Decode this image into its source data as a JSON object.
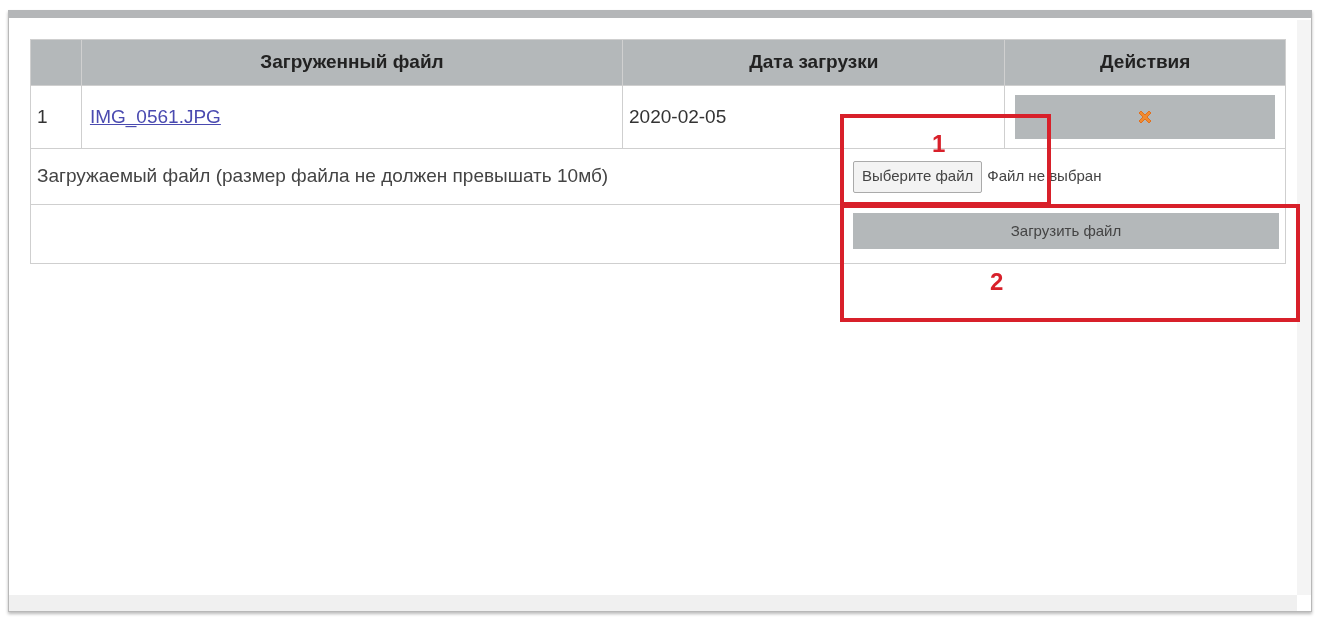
{
  "table": {
    "columns": [
      {},
      {
        "label": "Загруженный файл"
      },
      {
        "label": "Дата загрузки"
      },
      {
        "label": "Действия"
      }
    ],
    "rows": [
      {
        "index": "1",
        "file": "IMG_0561.JPG",
        "date": "2020-02-05"
      }
    ]
  },
  "upload": {
    "label": "Загружаемый файл (размер файла не должен превышать 10мб)",
    "choose_button": "Выберите файл",
    "no_file": "Файл не выбран",
    "submit_button": "Загрузить файл"
  },
  "annotations": [
    {
      "label": "1"
    },
    {
      "label": "2"
    }
  ]
}
